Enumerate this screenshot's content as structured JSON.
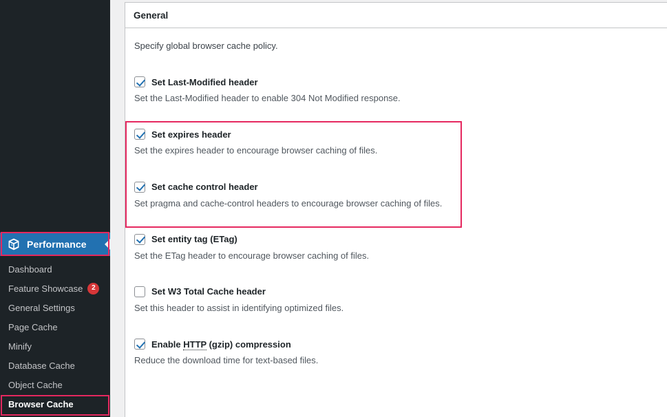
{
  "sidebar": {
    "menu": {
      "label": "Performance",
      "icon": "cube-icon",
      "collapse_arrow": "chevron-left-icon"
    },
    "items": [
      {
        "label": "Dashboard",
        "badge": null,
        "current": false
      },
      {
        "label": "Feature Showcase",
        "badge": "2",
        "current": false
      },
      {
        "label": "General Settings",
        "badge": null,
        "current": false
      },
      {
        "label": "Page Cache",
        "badge": null,
        "current": false
      },
      {
        "label": "Minify",
        "badge": null,
        "current": false
      },
      {
        "label": "Database Cache",
        "badge": null,
        "current": false
      },
      {
        "label": "Object Cache",
        "badge": null,
        "current": false
      },
      {
        "label": "Browser Cache",
        "badge": null,
        "current": true
      }
    ]
  },
  "panel": {
    "title": "General",
    "intro": "Specify global browser cache policy.",
    "fields": [
      {
        "label": "Set Last-Modified header",
        "description": "Set the Last-Modified header to enable 304 Not Modified response.",
        "checked": true
      },
      {
        "label": "Set expires header",
        "description": "Set the expires header to encourage browser caching of files.",
        "checked": true
      },
      {
        "label": "Set cache control header",
        "description": "Set pragma and cache-control headers to encourage browser caching of files.",
        "checked": true
      },
      {
        "label": "Set entity tag (ETag)",
        "description": "Set the ETag header to encourage browser caching of files.",
        "checked": true
      },
      {
        "label": "Set W3 Total Cache header",
        "description": "Set this header to assist in identifying optimized files.",
        "checked": false
      },
      {
        "label_prefix": "Enable ",
        "label_abbr": "HTTP",
        "label_suffix": " (gzip) compression",
        "label": "Enable HTTP (gzip) compression",
        "description": "Reduce the download time for text-based files.",
        "checked": true
      }
    ]
  },
  "annotations": {
    "highlight_color": "#e5285f",
    "boxes": [
      {
        "target": "performance-menu"
      },
      {
        "target": "browser-cache-item"
      },
      {
        "target": "expires-and-cache-control-fields"
      }
    ]
  },
  "colors": {
    "sidebar_bg": "#1d2327",
    "menu_active_bg": "#2271b1",
    "badge_bg": "#d63638",
    "checkmark": "#2271b1",
    "annotation": "#e5285f"
  }
}
